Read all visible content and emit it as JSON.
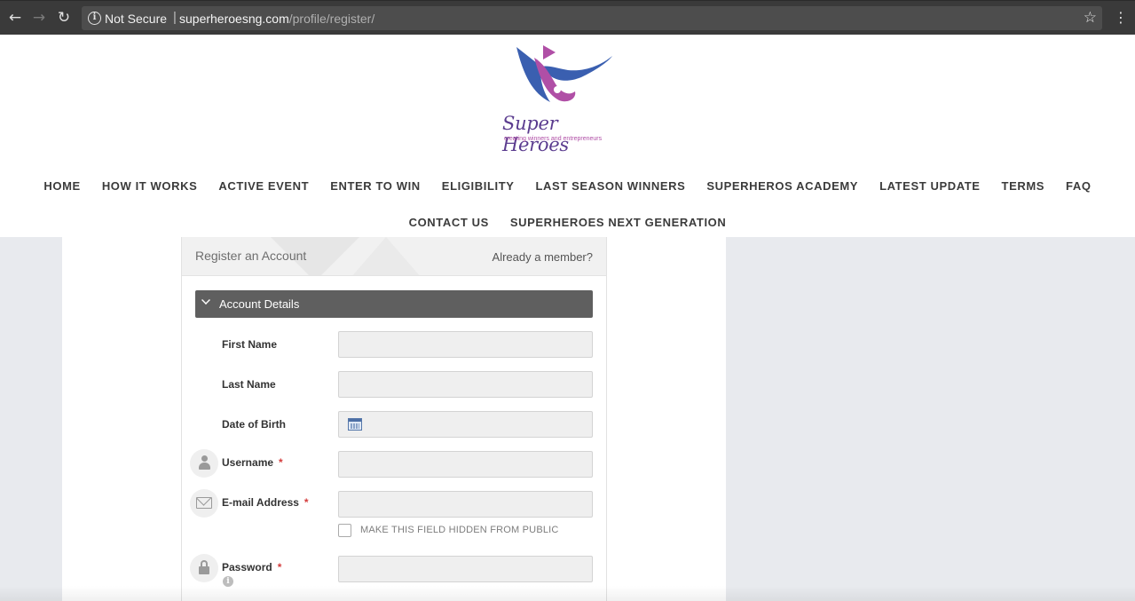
{
  "browser": {
    "back_icon": "←",
    "forward_icon": "→",
    "reload_icon": "↻",
    "info_icon": "i",
    "security_label": "Not Secure",
    "separator": "|",
    "url_host": "superheroesng.com",
    "url_path": "/profile/register/",
    "star_icon": "☆",
    "menu_icon": "⋮"
  },
  "site": {
    "logo_title": "Super Heroes",
    "logo_tagline": "creating winners and entrepreneurs",
    "brand_colors": {
      "purple": "#5b3c8f",
      "magenta": "#b04fa6",
      "blue": "#3a5fb0"
    }
  },
  "nav": {
    "row1": [
      "HOME",
      "HOW IT WORKS",
      "ACTIVE EVENT",
      "ENTER TO WIN",
      "ELIGIBILITY",
      "LAST SEASON WINNERS",
      "SUPERHEROS ACADEMY",
      "LATEST UPDATE",
      "TERMS",
      "FAQ"
    ],
    "row2": [
      "CONTACT US",
      "SUPERHEROES NEXT GENERATION"
    ]
  },
  "form": {
    "title": "Register an Account",
    "member_link": "Already a member?",
    "section_label": "Account Details",
    "fields": {
      "first_name": {
        "label": "First Name",
        "value": ""
      },
      "last_name": {
        "label": "Last Name",
        "value": ""
      },
      "dob": {
        "label": "Date of Birth",
        "value": ""
      },
      "username": {
        "label": "Username",
        "required": "*",
        "value": ""
      },
      "email": {
        "label": "E-mail Address",
        "required": "*",
        "value": ""
      },
      "password": {
        "label": "Password",
        "required": "*",
        "value": ""
      }
    },
    "hide_checkbox_label": "MAKE THIS FIELD HIDDEN FROM PUBLIC",
    "help_icon": "i"
  }
}
